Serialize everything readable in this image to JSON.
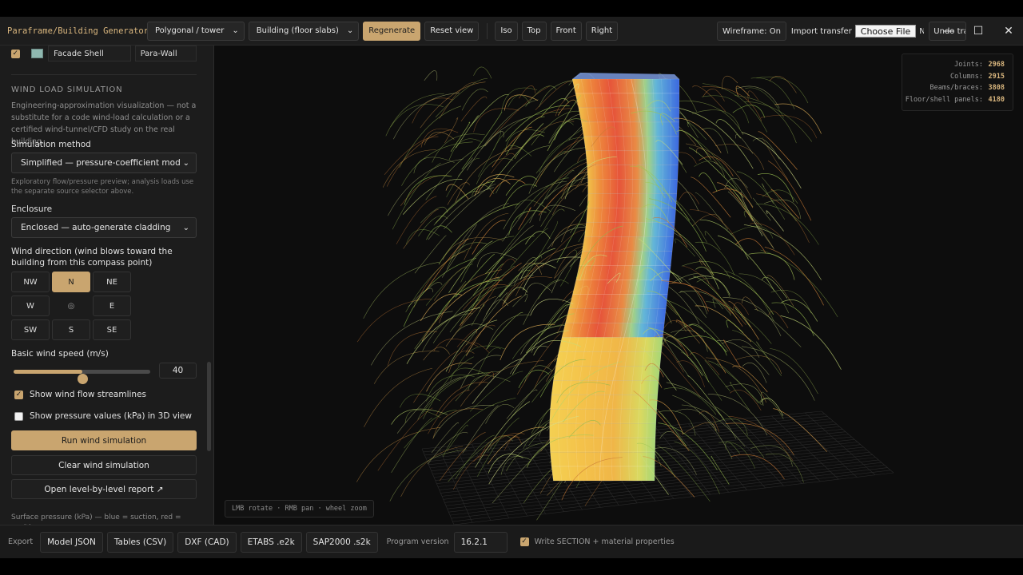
{
  "app": {
    "title": "Paraframe/Building Generator"
  },
  "toolbar": {
    "form_select": "Polygonal / tower",
    "model_select": "Building (floor slabs)",
    "regenerate": "Regenerate",
    "reset_view": "Reset view",
    "views": [
      "Iso",
      "Top",
      "Front",
      "Right"
    ],
    "wireframe": "Wireframe: On",
    "import_label": "Import transfer",
    "choose_file": "Choose File",
    "file_status": "N",
    "undo": "Undo transfer"
  },
  "window_controls": {
    "minimize": "—",
    "maximize": "☐",
    "close": "✕"
  },
  "sidebar": {
    "layer": {
      "checked": true,
      "color": "#8fb8b0",
      "name": "Facade Shell",
      "type": "Para-Wall"
    },
    "wind": {
      "section_title": "WIND LOAD SIMULATION",
      "disclaimer": "Engineering-approximation visualization — not a substitute for a code wind-load calculation or a certified wind-tunnel/CFD study on the real building.",
      "method_label": "Simulation method",
      "method_value": "Simplified — pressure-coefficient model (fast)",
      "method_hint": "Exploratory flow/pressure preview; analysis loads use the separate source selector above.",
      "enclosure_label": "Enclosure",
      "enclosure_value": "Enclosed — auto-generate cladding",
      "direction_label": "Wind direction (wind blows toward the building from this compass point)",
      "directions": [
        "NW",
        "N",
        "NE",
        "W",
        "◎",
        "E",
        "SW",
        "S",
        "SE"
      ],
      "active_direction": "N",
      "speed_label": "Basic wind speed (m/s)",
      "speed_value": "40",
      "speed_min": 0,
      "speed_max": 80,
      "show_streamlines_label": "Show wind flow streamlines",
      "show_streamlines": true,
      "show_pressure_label": "Show pressure values (kPa) in 3D view",
      "show_pressure": false,
      "run_button": "Run wind simulation",
      "clear_button": "Clear wind simulation",
      "report_button": "Open level-by-level report ↗",
      "legend_text": "Surface pressure (kPa) — blue = suction, red = positive pressure"
    }
  },
  "viewport": {
    "stats": [
      {
        "label": "Joints:",
        "value": "2968"
      },
      {
        "label": "Columns:",
        "value": "2915"
      },
      {
        "label": "Beams/braces:",
        "value": "3808"
      },
      {
        "label": "Floor/shell panels:",
        "value": "4180"
      }
    ],
    "hint": "LMB rotate · RMB pan · wheel zoom"
  },
  "bottombar": {
    "export_label": "Export",
    "buttons": [
      "Model JSON",
      "Tables (CSV)",
      "DXF (CAD)",
      "ETABS .e2k",
      "SAP2000 .s2k"
    ],
    "version_label": "Program version",
    "version_value": "16.2.1",
    "write_section_label": "Write SECTION + material properties",
    "write_section": true
  },
  "colors": {
    "accent": "#c9a56f",
    "suction": "#3f6fe0",
    "positive": "#e8553a",
    "streamline_green": "#a9c85a",
    "streamline_orange": "#e0a24a"
  }
}
